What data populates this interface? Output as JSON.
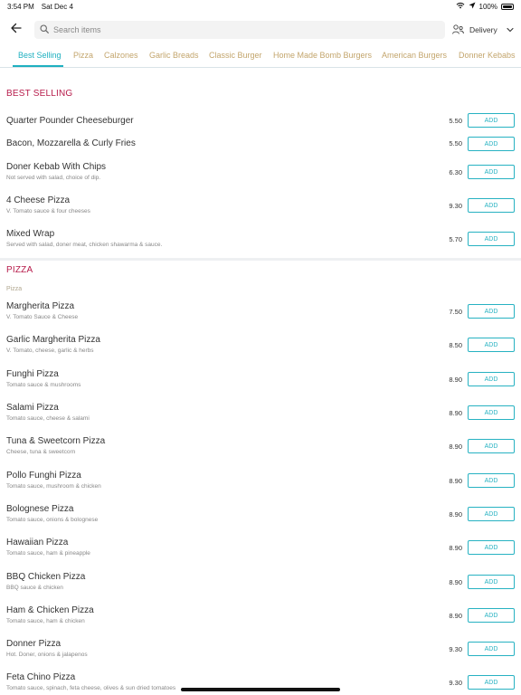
{
  "status_bar": {
    "time": "3:54 PM",
    "date": "Sat Dec 4",
    "battery": "100%"
  },
  "header": {
    "search_placeholder": "Search items",
    "delivery_label": "Delivery"
  },
  "tabs": [
    {
      "label": "Best Selling",
      "active": true
    },
    {
      "label": "Pizza"
    },
    {
      "label": "Calzones"
    },
    {
      "label": "Garlic Breads"
    },
    {
      "label": "Classic Burger"
    },
    {
      "label": "Home Made Bomb Burgers"
    },
    {
      "label": "American Burgers"
    },
    {
      "label": "Donner Kebabs"
    }
  ],
  "add_label": "ADD",
  "best_selling": {
    "title": "BEST SELLING",
    "items": [
      {
        "name": "Quarter Pounder Cheeseburger",
        "desc": "",
        "price": "5.50"
      },
      {
        "name": "Bacon, Mozzarella & Curly Fries",
        "desc": "",
        "price": "5.50"
      },
      {
        "name": "Doner Kebab With Chips",
        "desc": "Not served with salad, choice of dip.",
        "price": "6.30"
      },
      {
        "name": "4 Cheese Pizza",
        "desc": "V. Tomato sauce & four cheeses",
        "price": "9.30"
      },
      {
        "name": "Mixed Wrap",
        "desc": "Served with salad, doner meat, chicken shawarma & sauce.",
        "price": "5.70"
      }
    ]
  },
  "pizza": {
    "title": "PIZZA",
    "subtitle": "Pizza",
    "items": [
      {
        "name": "Margherita Pizza",
        "desc": "V. Tomato Sauce & Cheese",
        "price": "7.50"
      },
      {
        "name": "Garlic Margherita Pizza",
        "desc": "V. Tomato, cheese, garlic & herbs",
        "price": "8.50"
      },
      {
        "name": "Funghi Pizza",
        "desc": "Tomato sauce & mushrooms",
        "price": "8.90"
      },
      {
        "name": "Salami Pizza",
        "desc": "Tomato sauce, cheese & salami",
        "price": "8.90"
      },
      {
        "name": "Tuna & Sweetcorn Pizza",
        "desc": "Cheese, tuna & sweetcorn",
        "price": "8.90"
      },
      {
        "name": "Pollo Funghi Pizza",
        "desc": "Tomato sauce, mushroom & chicken",
        "price": "8.90"
      },
      {
        "name": "Bolognese Pizza",
        "desc": "Tomato sauce, onions & bolognese",
        "price": "8.90"
      },
      {
        "name": "Hawaiian Pizza",
        "desc": "Tomato sauce, ham & pineapple",
        "price": "8.90"
      },
      {
        "name": "BBQ Chicken Pizza",
        "desc": "BBQ sauce & chicken",
        "price": "8.90"
      },
      {
        "name": "Ham & Chicken Pizza",
        "desc": "Tomato sauce, ham & chicken",
        "price": "8.90"
      },
      {
        "name": "Donner Pizza",
        "desc": "Hot. Doner, onions & jalapenos",
        "price": "9.30"
      },
      {
        "name": "Feta Chino Pizza",
        "desc": "Tomato sauce, spinach, feta cheese, olives & sun dried tomatoes",
        "price": "9.30"
      }
    ]
  }
}
